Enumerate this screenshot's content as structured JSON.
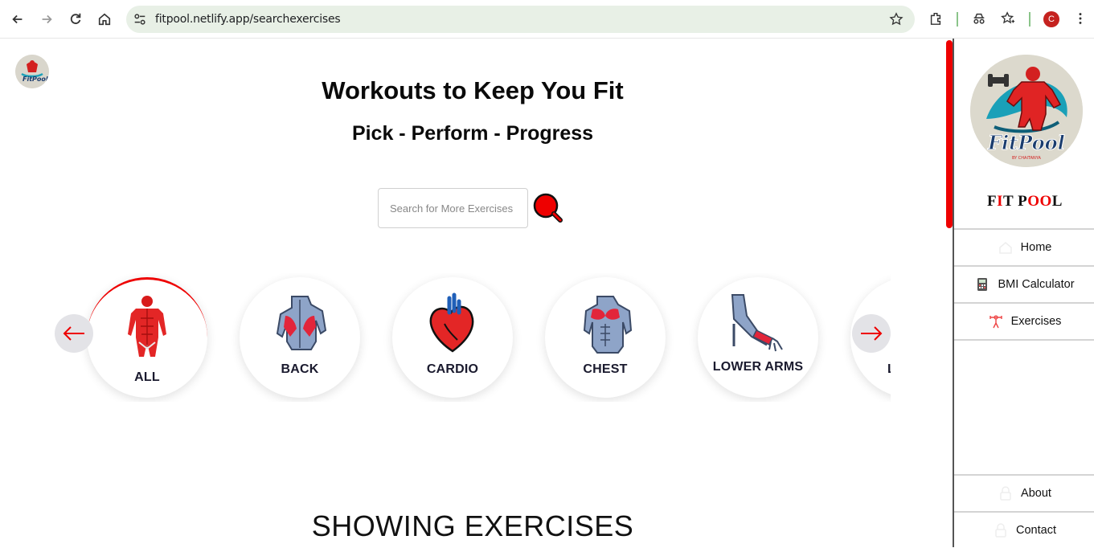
{
  "browser": {
    "url": "fitpool.netlify.app/searchexercises",
    "profile_initial": "C"
  },
  "page": {
    "title": "Workouts to Keep You Fit",
    "subtitle": "Pick - Perform - Progress",
    "search": {
      "placeholder": "Search for More Exercises"
    },
    "categories": [
      {
        "label": "ALL",
        "icon": "full-body-muscles-icon"
      },
      {
        "label": "BACK",
        "icon": "back-muscles-icon"
      },
      {
        "label": "CARDIO",
        "icon": "heart-icon"
      },
      {
        "label": "CHEST",
        "icon": "chest-muscles-icon"
      },
      {
        "label": "LOWER ARMS",
        "icon": "lower-arm-icon"
      },
      {
        "label": "LOW",
        "icon": "lower-legs-icon"
      }
    ],
    "section_heading": "SHOWING EXERCISES"
  },
  "sidebar": {
    "brand_parts": [
      "F",
      "I",
      "T ",
      "P",
      "OO",
      "L"
    ],
    "menu": [
      {
        "label": "Home",
        "icon": "home-icon"
      },
      {
        "label": "BMI Calculator",
        "icon": "calculator-icon"
      },
      {
        "label": "Exercises",
        "icon": "dumbbell-icon"
      },
      {
        "label": "About",
        "icon": "lock-icon"
      },
      {
        "label": "Contact",
        "icon": "lock-icon"
      }
    ]
  },
  "colors": {
    "accent": "#ee0000",
    "text": "#0a0a0a",
    "omnibox": "#e8f0e6"
  }
}
